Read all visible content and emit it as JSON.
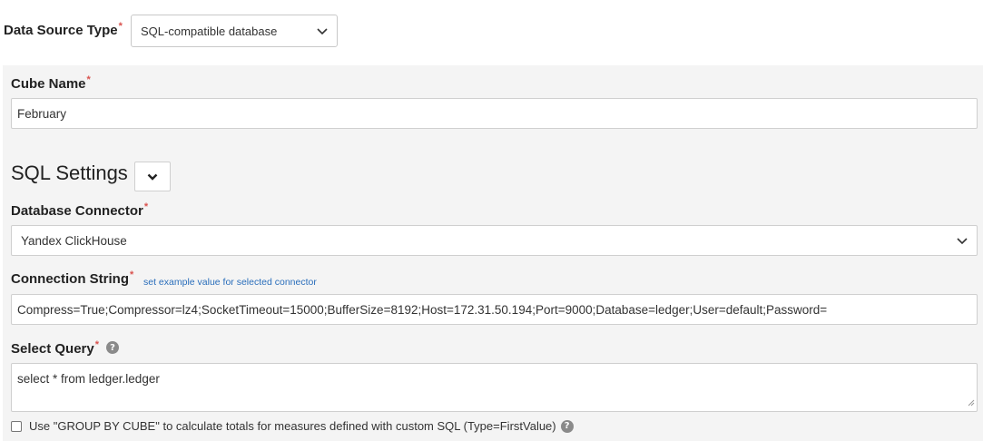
{
  "data_source": {
    "label": "Data Source Type",
    "required_mark": "*",
    "selected": "SQL-compatible database",
    "icon": "chevron-down-icon"
  },
  "cube_name": {
    "label": "Cube Name",
    "required_mark": "*",
    "value": "February"
  },
  "sql_settings": {
    "title": "SQL Settings",
    "toggle_icon": "chevron-down-icon"
  },
  "database_connector": {
    "label": "Database Connector",
    "required_mark": "*",
    "selected": "Yandex ClickHouse"
  },
  "connection_string": {
    "label": "Connection String",
    "required_mark": "*",
    "example_link": "set example value for selected connector",
    "value": "Compress=True;Compressor=lz4;SocketTimeout=15000;BufferSize=8192;Host=172.31.50.194;Port=9000;Database=ledger;User=default;Password="
  },
  "select_query": {
    "label": "Select Query",
    "required_mark": "*",
    "help_icon": "question-circle-icon",
    "help_glyph": "?",
    "value": "select * from ledger.ledger"
  },
  "group_by_cube": {
    "checked": false,
    "label": "Use \"GROUP BY CUBE\" to calculate totals for measures defined with custom SQL (Type=FirstValue)",
    "help_icon": "question-circle-icon",
    "help_glyph": "?"
  },
  "colors": {
    "panel_bg": "#f4f4f4",
    "required": "#d9534f",
    "link": "#2a6ebb"
  }
}
